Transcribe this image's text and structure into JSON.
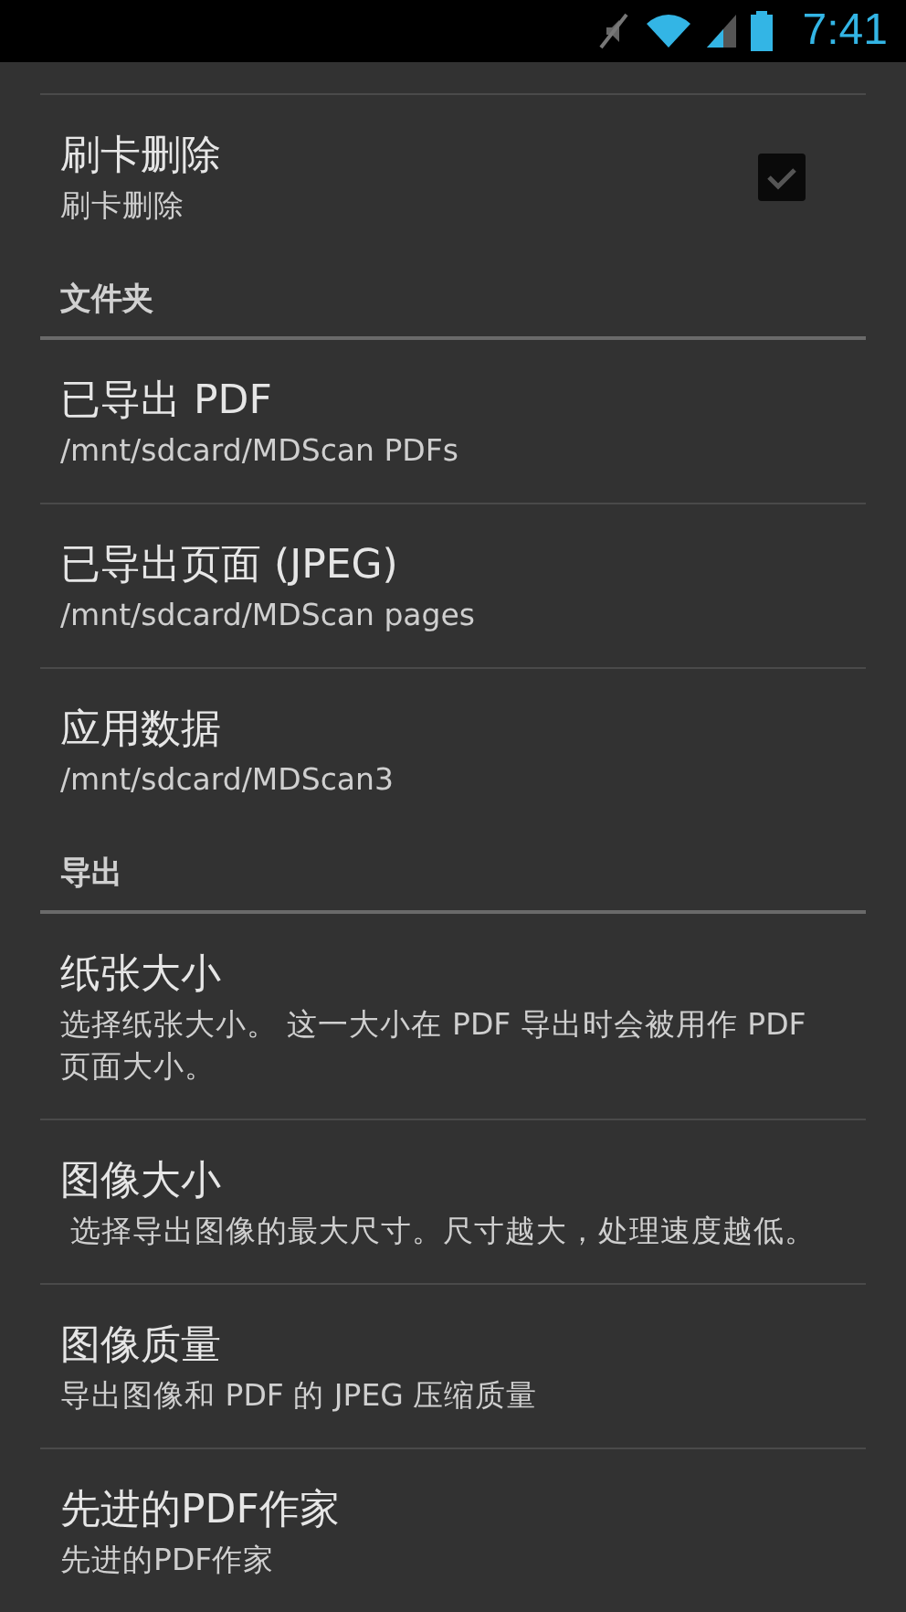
{
  "status_bar": {
    "time": "7:41"
  },
  "items": [
    {
      "kind": "pref",
      "title": "刷卡删除",
      "summary": "刷卡删除",
      "checked": true
    },
    {
      "kind": "section",
      "title": "文件夹"
    },
    {
      "kind": "pref",
      "title": "已导出 PDF",
      "summary": "/mnt/sdcard/MDScan PDFs"
    },
    {
      "kind": "pref",
      "title": "已导出页面 (JPEG)",
      "summary": "/mnt/sdcard/MDScan pages"
    },
    {
      "kind": "pref",
      "title": "应用数据",
      "summary": "/mnt/sdcard/MDScan3"
    },
    {
      "kind": "section",
      "title": "导出"
    },
    {
      "kind": "pref",
      "title": "纸张大小",
      "summary": "选择纸张大小。 这一大小在 PDF 导出时会被用作 PDF 页面大小。"
    },
    {
      "kind": "pref",
      "title": "图像大小",
      "summary": " 选择导出图像的最大尺寸。尺寸越大，处理速度越低。"
    },
    {
      "kind": "pref",
      "title": "图像质量",
      "summary": "导出图像和 PDF 的 JPEG 压缩质量"
    },
    {
      "kind": "pref",
      "title": "先进的PDF作家",
      "summary": "先进的PDF作家"
    }
  ]
}
